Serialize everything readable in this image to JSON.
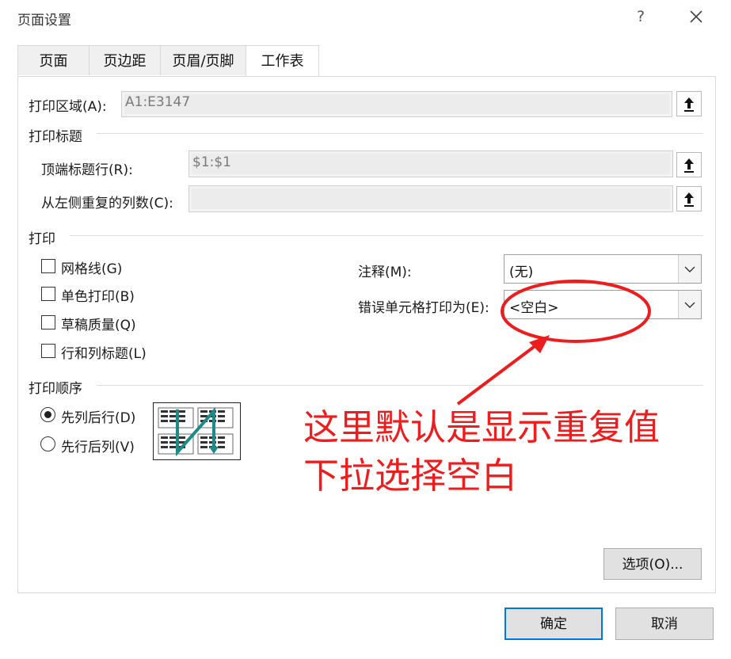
{
  "window": {
    "title": "页面设置",
    "help": "?",
    "close": "✕"
  },
  "tabs": [
    "页面",
    "页边距",
    "页眉/页脚",
    "工作表"
  ],
  "print_area": {
    "label": "打印区域(A):",
    "value": "A1:E3147"
  },
  "print_titles": {
    "section": "打印标题",
    "rows_label": "顶端标题行(R):",
    "rows_value": "$1:$1",
    "cols_label": "从左侧重复的列数(C):",
    "cols_value": ""
  },
  "print": {
    "section": "打印",
    "checkboxes": [
      {
        "label": "网格线(G)",
        "checked": false
      },
      {
        "label": "单色打印(B)",
        "checked": false
      },
      {
        "label": "草稿质量(Q)",
        "checked": false
      },
      {
        "label": "行和列标题(L)",
        "checked": false
      }
    ],
    "comments_label": "注释(M):",
    "comments_value": "(无)",
    "errors_label": "错误单元格打印为(E):",
    "errors_value": "<空白>"
  },
  "print_order": {
    "section": "打印顺序",
    "options": [
      {
        "label": "先列后行(D)",
        "selected": true
      },
      {
        "label": "先行后列(V)",
        "selected": false
      }
    ]
  },
  "annotation": {
    "line1": "这里默认是显示重复值",
    "line2": "下拉选择空白",
    "color": "#ee1c1c"
  },
  "buttons": {
    "options": "选项(O)...",
    "ok": "确定",
    "cancel": "取消"
  },
  "colors": {
    "accent": "#0078d7",
    "order_icon": "#1e8a8a"
  }
}
